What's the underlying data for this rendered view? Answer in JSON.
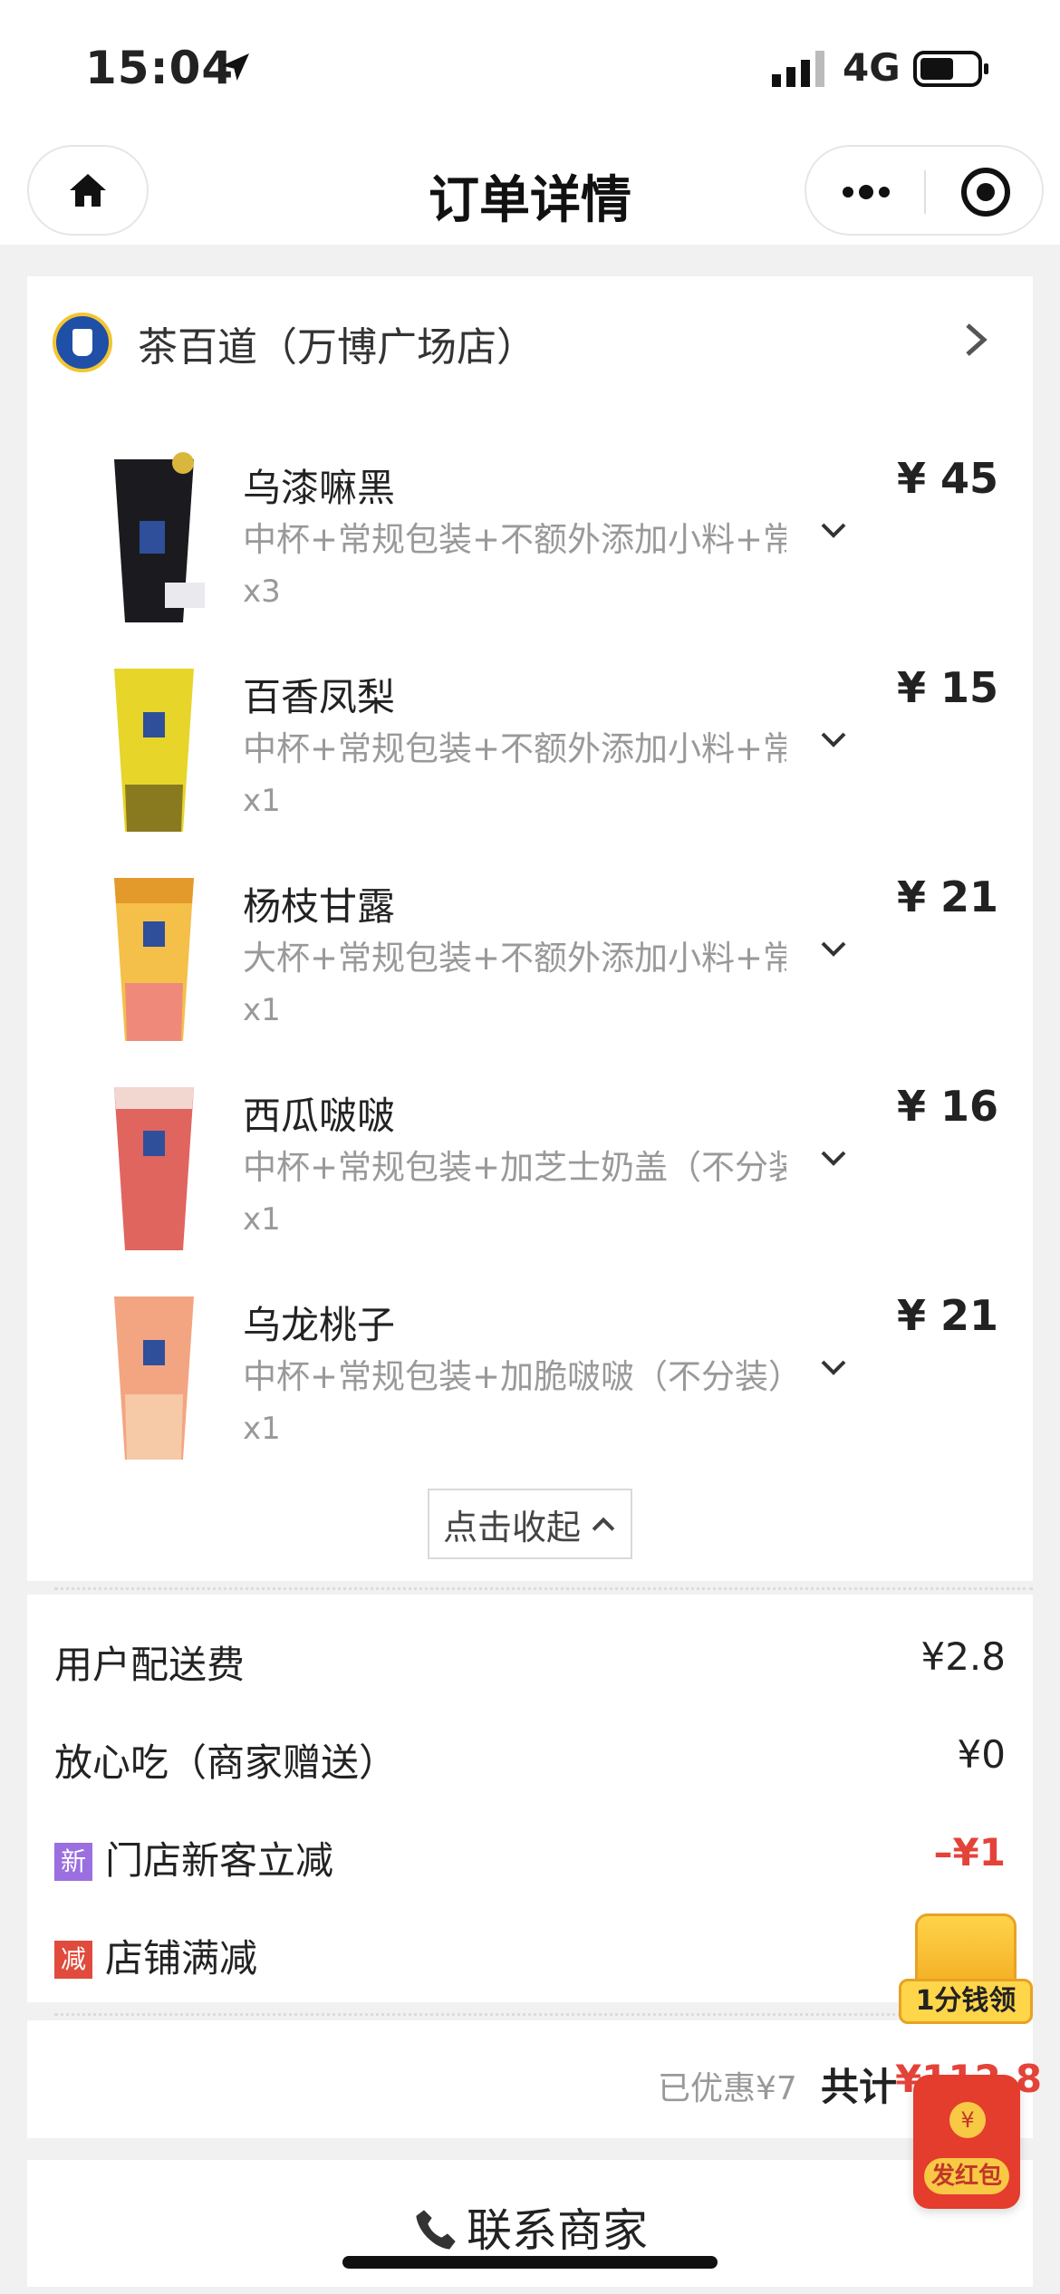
{
  "status_bar": {
    "time": "15:04",
    "network": "4G"
  },
  "nav": {
    "title": "订单详情"
  },
  "store": {
    "name": "茶百道（万博广场店）"
  },
  "items": [
    {
      "name": "乌漆嘛黑",
      "price": "¥ 45",
      "spec": "中杯+常规包装+不额外添加小料+常…",
      "qty": "x3"
    },
    {
      "name": "百香凤梨",
      "price": "¥ 15",
      "spec": "中杯+常规包装+不额外添加小料+常…",
      "qty": "x1"
    },
    {
      "name": "杨枝甘露",
      "price": "¥ 21",
      "spec": "大杯+常规包装+不额外添加小料+常…",
      "qty": "x1"
    },
    {
      "name": "西瓜啵啵",
      "price": "¥ 16",
      "spec": "中杯+常规包装+加芝士奶盖（不分装…",
      "qty": "x1"
    },
    {
      "name": "乌龙桃子",
      "price": "¥ 21",
      "spec": "中杯+常规包装+加脆啵啵（不分装）…",
      "qty": "x1"
    }
  ],
  "collapse_label": "点击收起",
  "fees": {
    "delivery": {
      "label": "用户配送费",
      "value": "¥2.8"
    },
    "insurance": {
      "label": "放心吃（商家赠送）",
      "value": "¥0"
    },
    "new_customer": {
      "badge": "新",
      "label": "门店新客立减",
      "value": "–¥1"
    },
    "full_discount": {
      "badge": "减",
      "label": "店铺满减"
    }
  },
  "summary": {
    "saved": "已优惠¥7",
    "total_label": "共计",
    "total_value": "¥112.8"
  },
  "contact": {
    "label": "联系商家"
  },
  "floating": {
    "gift_label": "1分钱领",
    "red_packet_label": "发红包",
    "coin": "¥"
  },
  "colors": {
    "price_red": "#e4433a",
    "badge_purple": "#9b6fe0",
    "badge_red": "#e04b3d"
  }
}
